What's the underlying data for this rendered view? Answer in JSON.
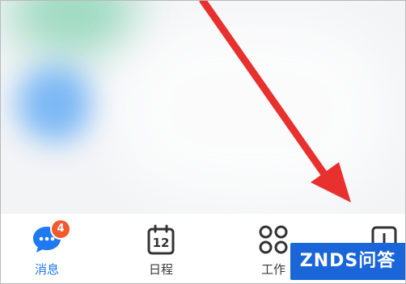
{
  "tabs": [
    {
      "label": "消息",
      "icon": "chat-bubble-icon",
      "badge": "4",
      "active": true
    },
    {
      "label": "日程",
      "icon": "calendar-icon",
      "date": "12"
    },
    {
      "label": "工作",
      "icon": "grid-icon"
    },
    {
      "label": "",
      "icon": "contacts-icon"
    }
  ],
  "watermark": "ZNDS问答",
  "colors": {
    "accent": "#1e79f2",
    "badge": "#f2592d",
    "arrow": "#e8312f",
    "watermark": "#1a66d9"
  }
}
